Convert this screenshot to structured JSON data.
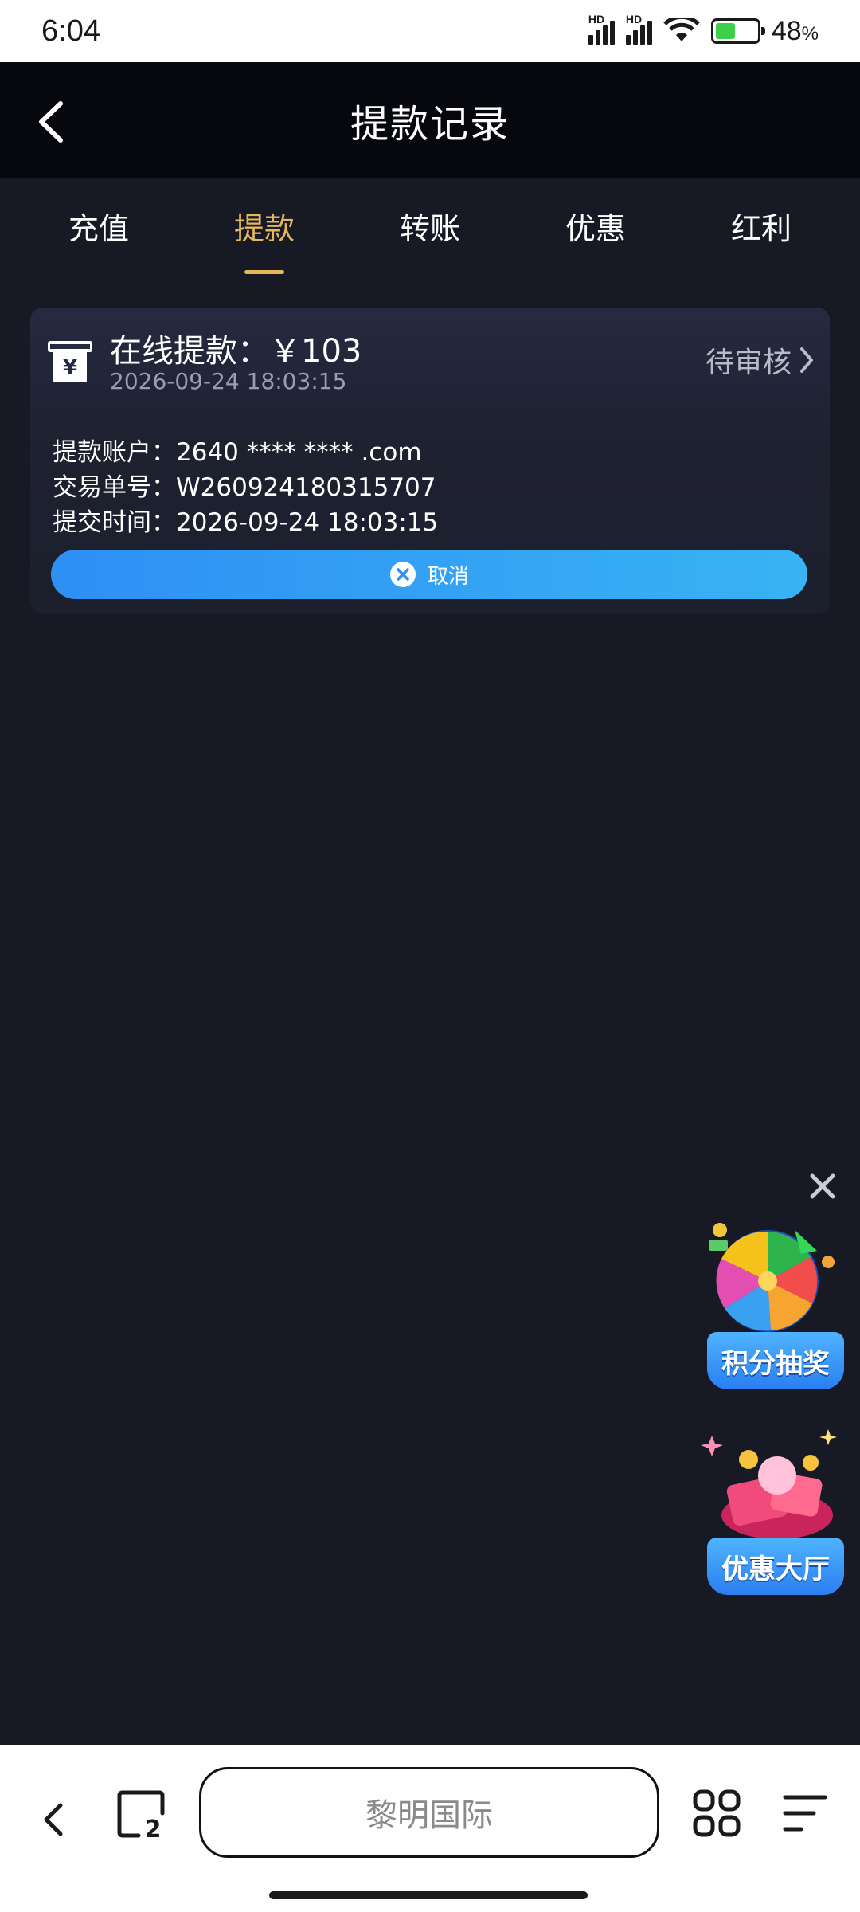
{
  "status_bar": {
    "time": "6:04",
    "network_label_1": "HD",
    "network_label_2": "HD",
    "battery_percent": "48",
    "battery_unit": "%",
    "battery_level": 0.48
  },
  "header": {
    "title": "提款记录",
    "back_icon": "chevron-left-icon"
  },
  "tabs": [
    {
      "label": "充值",
      "active": false
    },
    {
      "label": "提款",
      "active": true
    },
    {
      "label": "转账",
      "active": false
    },
    {
      "label": "优惠",
      "active": false
    },
    {
      "label": "红利",
      "active": false
    }
  ],
  "record": {
    "title": "在线提款：￥103",
    "date": "2026-09-24 18:03:15",
    "status": "待审核",
    "account_label": "提款账户：",
    "account_value": "2640 **** **** .com",
    "order_label": "交易单号：",
    "order_value": "W260924180315707",
    "submit_label": "提交时间：",
    "submit_value": "2026-09-24 18:03:15",
    "cancel_label": "取消",
    "icon": "yen-receipt-icon"
  },
  "floating": {
    "lottery_label": "积分抽奖",
    "promo_hall_label": "优惠大厅"
  },
  "browser": {
    "url_text": "黎明国际",
    "tab_count": "2"
  },
  "colors": {
    "accent": "#e3b75a",
    "background": "#171a24",
    "header": "#07080d",
    "button_start": "#2e8ff5",
    "button_end": "#39b3f3"
  }
}
